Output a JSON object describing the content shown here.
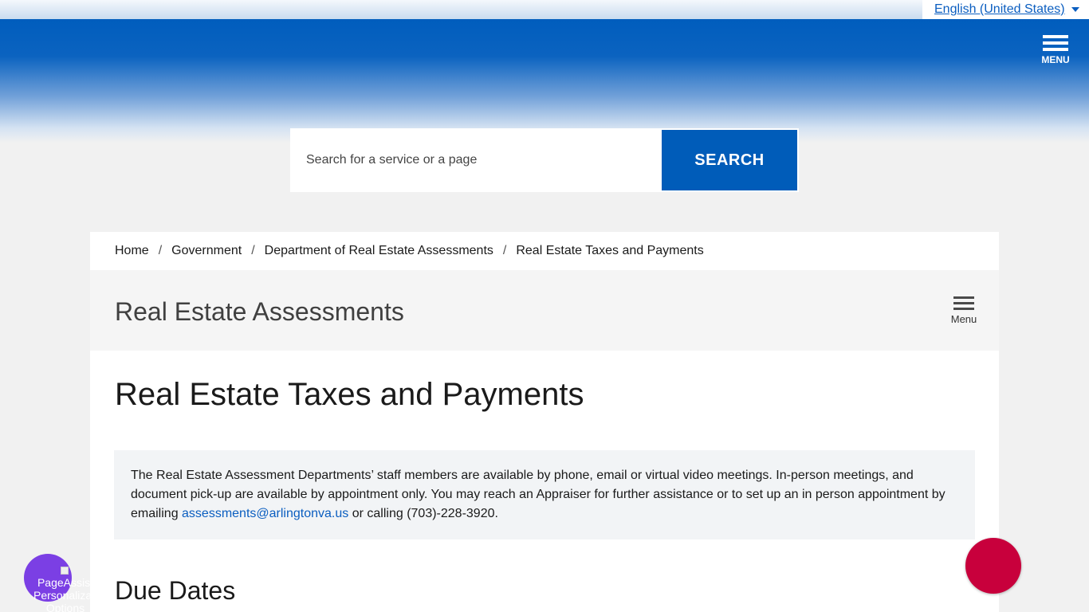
{
  "language_selector": {
    "label": "English (United States)"
  },
  "header": {
    "menu_label": "MENU"
  },
  "search": {
    "placeholder": "Search for a service or a page",
    "button_label": "SEARCH"
  },
  "breadcrumb": {
    "items": [
      "Home",
      "Government",
      "Department of Real Estate Assessments",
      "Real Estate Taxes and Payments"
    ],
    "separator": "/"
  },
  "section": {
    "title": "Real Estate Assessments",
    "menu_label": "Menu"
  },
  "page": {
    "title": "Real Estate Taxes and Payments",
    "notice": {
      "text_before": "The Real Estate Assessment Departments’ staff members are available by phone, email or virtual video meetings. In-person meetings, and document pick-up are available by appointment only. You may reach an Appraiser for further assistance or to set up an in person appointment by emailing ",
      "email": "assessments@arlingtonva.us",
      "text_after": " or calling (703)-228-3920."
    },
    "subheading": "Due Dates"
  },
  "page_assist": {
    "label": "PageAssist Personalization Options"
  },
  "colors": {
    "brand_blue": "#005cb9",
    "chat_red": "#c8003c",
    "assist_purple": "#7b3fe4",
    "link_blue": "#0b5ec0"
  },
  "icons": {
    "menu": "hamburger-icon",
    "caret": "caret-down-icon",
    "chat": "chat-icon"
  }
}
